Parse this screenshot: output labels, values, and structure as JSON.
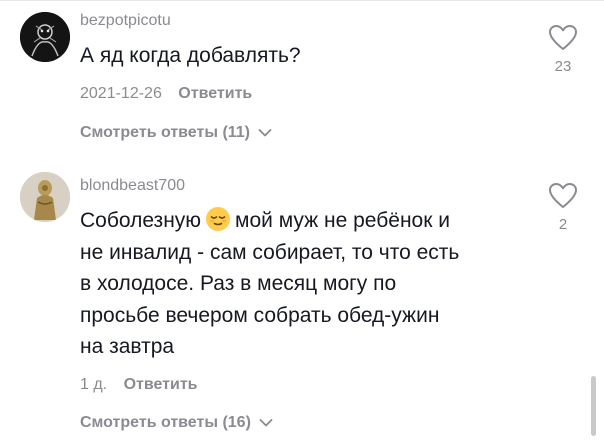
{
  "comments": [
    {
      "username": "bezpotpicotu",
      "avatar_icon": "dark-avatar-icon",
      "lines": [
        "А яд когда добавлять?"
      ],
      "date": "2021-12-26",
      "reply_label": "Ответить",
      "view_replies_label": "Смотреть ответы (11)",
      "like_count": "23"
    },
    {
      "username": "blondbeast700",
      "avatar_icon": "figurine-avatar-icon",
      "line1_before_emoji": "Соболезную",
      "emoji_icon": "relieved-face-emoji-icon",
      "line1_after_emoji": "мой муж не ребёнок и",
      "lines": [
        "не инвалид - сам собирает, то что есть",
        "в холодосе. Раз в месяц могу по",
        "просьбе вечером собрать обед-ужин",
        "на завтра"
      ],
      "date": "1 д.",
      "reply_label": "Ответить",
      "view_replies_label": "Смотреть ответы (16)",
      "like_count": "2"
    }
  ],
  "colors": {
    "primary_text": "#161823",
    "secondary_text": "#8a8b91",
    "background": "#ffffff"
  }
}
